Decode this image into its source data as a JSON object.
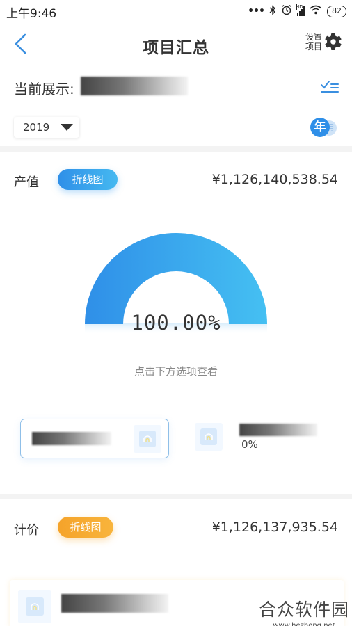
{
  "status_bar": {
    "time": "上午9:46",
    "battery": "82",
    "icons": [
      "dots-icon",
      "bluetooth-icon",
      "alarm-icon",
      "hd-signal-icon",
      "wifi-icon",
      "battery-icon"
    ]
  },
  "nav": {
    "title": "项目汇总",
    "back_icon": "chevron-left-icon",
    "settings_line1": "设置",
    "settings_line2": "项目",
    "settings_icon": "gear-icon",
    "accent": "#2f8fe8"
  },
  "current": {
    "label": "当前展示:",
    "value_redacted": true,
    "filter_icon": "checklist-icon"
  },
  "year_filter": {
    "selected": "2019",
    "period_year": "年",
    "period_month": "月"
  },
  "output_section": {
    "title": "产值",
    "chart_button": "折线图",
    "amount": "¥1,126,140,538.54",
    "gauge_percent": 100.0,
    "gauge_label": "100.00%",
    "hint": "点击下方选项查看",
    "items": [
      {
        "name_redacted": true,
        "selected": true,
        "icon": "project-thumbnail-icon"
      },
      {
        "name_redacted": true,
        "selected": false,
        "percent": "0%",
        "icon": "project-thumbnail-icon"
      }
    ],
    "colors": {
      "start": "#2f8fe8",
      "end": "#45c0f2"
    }
  },
  "price_section": {
    "title": "计价",
    "chart_button": "折线图",
    "amount": "¥1,126,137,935.54",
    "items": [
      {
        "name_redacted": true,
        "icon": "project-thumbnail-icon"
      }
    ],
    "colors": {
      "start": "#f5a32a",
      "end": "#f8b43c"
    }
  },
  "watermark": {
    "title": "合众软件园",
    "url": "www.hezhong.net"
  }
}
